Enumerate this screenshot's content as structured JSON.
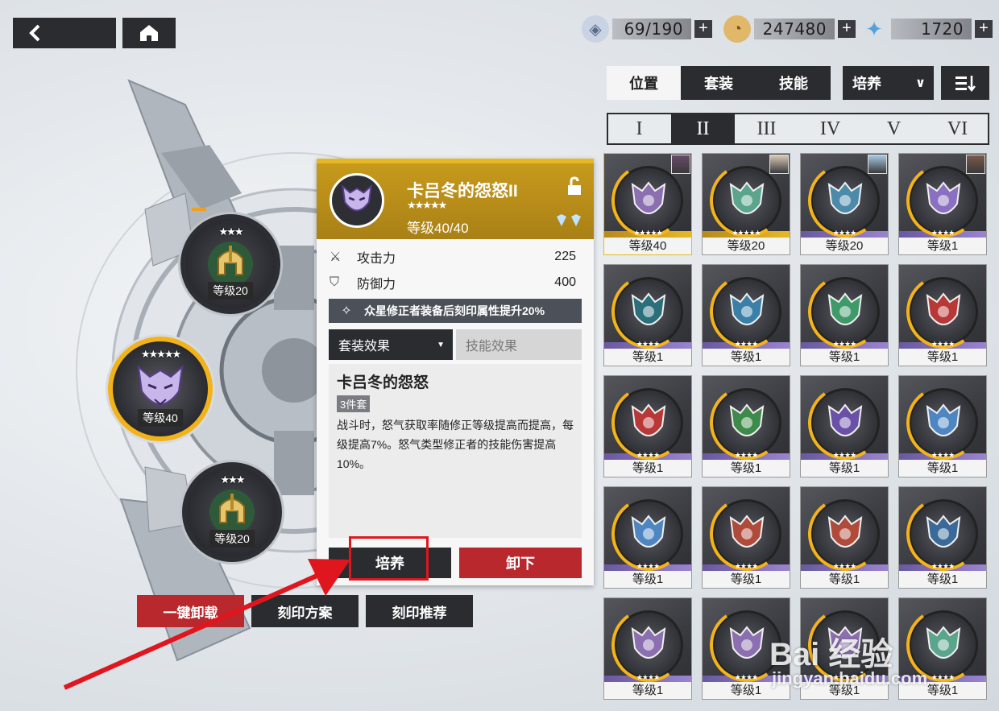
{
  "top_bar": {
    "back_icon": "chevron-left-icon",
    "home_icon": "home-icon",
    "resources": [
      {
        "name": "stamina",
        "icon": "robot-stamina-icon",
        "value": "69/190"
      },
      {
        "name": "coins",
        "icon": "coin-icon",
        "value": "247480"
      },
      {
        "name": "crystal",
        "icon": "star-crystal-icon",
        "value": "1720"
      }
    ],
    "plus": "+"
  },
  "machine": {
    "slots": [
      {
        "stars": "★★★",
        "level": "等级20"
      },
      {
        "stars": "★★★★★",
        "level": "等级40"
      },
      {
        "stars": "★★★",
        "level": "等级20"
      }
    ]
  },
  "bottom_buttons": {
    "unequip_all": "一键卸载",
    "imprint_plan": "刻印方案",
    "imprint_recommend": "刻印推荐"
  },
  "detail": {
    "title": "卡吕冬的怨怒II",
    "stars": "★★★★★",
    "level": "等级40/40",
    "stats": [
      {
        "icon": "sword-icon",
        "label": "攻击力",
        "value": "225"
      },
      {
        "icon": "shield-icon",
        "label": "防御力",
        "value": "400"
      }
    ],
    "bonus": "众星修正者装备后刻印属性提升20%",
    "tabs": {
      "set_effect": "套装效果",
      "skill_effect": "技能效果",
      "dropdown_mark": "▼"
    },
    "set_name": "卡吕冬的怨怒",
    "set_badge": "3件套",
    "set_desc": "战斗时，怒气获取率随修正等级提高而提高，每级提高7%。怒气类型修正者的技能伤害提高10%。",
    "train": "培养",
    "unequip": "卸下"
  },
  "right": {
    "tabs": [
      "位置",
      "套装",
      "技能"
    ],
    "filter": "培养",
    "filter_arrow": "∨",
    "sort_icon": "sort-icon",
    "positions": [
      "I",
      "II",
      "III",
      "IV",
      "V",
      "VI"
    ],
    "active_position": 1,
    "cards": [
      {
        "emblem": "demon-mask-purple",
        "stars": "★★★★★",
        "level": "等级40",
        "color": "#8b6fb0"
      },
      {
        "emblem": "infinity-knot",
        "stars": "★★★★★",
        "level": "等级20",
        "color": "#5aa58c"
      },
      {
        "emblem": "temple-pillar",
        "stars": "★★★★",
        "level": "等级20",
        "color": "#4b8aa8"
      },
      {
        "emblem": "winged-banner",
        "stars": "★★★★",
        "level": "等级1",
        "color": "#8a70c0"
      },
      {
        "emblem": "spear-head",
        "stars": "★★★★",
        "level": "等级1",
        "color": "#2a6f7a"
      },
      {
        "emblem": "swan",
        "stars": "★★★★",
        "level": "等级1",
        "color": "#3a7fa8"
      },
      {
        "emblem": "lyre",
        "stars": "★★★★",
        "level": "等级1",
        "color": "#3f9a6a"
      },
      {
        "emblem": "red-oni-swords",
        "stars": "★★★★",
        "level": "等级1",
        "color": "#b83838"
      },
      {
        "emblem": "red-oni-swords",
        "stars": "★★★★",
        "level": "等级1",
        "color": "#b83838"
      },
      {
        "emblem": "golden-phoenix",
        "stars": "★★★★",
        "level": "等级1",
        "color": "#3e8a4a"
      },
      {
        "emblem": "purple-crest",
        "stars": "★★★★",
        "level": "等级1",
        "color": "#6b50a8"
      },
      {
        "emblem": "blue-dragon",
        "stars": "★★★★",
        "level": "等级1",
        "color": "#4e86c2"
      },
      {
        "emblem": "blue-dragon",
        "stars": "★★★★",
        "level": "等级1",
        "color": "#4e86c2"
      },
      {
        "emblem": "flame-crest",
        "stars": "★★★★",
        "level": "等级1",
        "color": "#b04a3a"
      },
      {
        "emblem": "flame-crest",
        "stars": "★★★★",
        "level": "等级1",
        "color": "#b04a3a"
      },
      {
        "emblem": "blue-swirl",
        "stars": "★★★★",
        "level": "等级1",
        "color": "#3a6a9a"
      },
      {
        "emblem": "demon-mask-purple",
        "stars": "★★★★",
        "level": "等级1",
        "color": "#8b6fb0"
      },
      {
        "emblem": "demon-mask-purple",
        "stars": "★★★★",
        "level": "等级1",
        "color": "#8b6fb0"
      },
      {
        "emblem": "demon-mask-purple",
        "stars": "★★★★",
        "level": "等级1",
        "color": "#8b6fb0"
      },
      {
        "emblem": "infinity-knot",
        "stars": "★★★★",
        "level": "等级1",
        "color": "#5aa58c"
      }
    ]
  },
  "watermark": {
    "main": "Bai 经验",
    "sub": "jingyan.baidu.com"
  },
  "colors": {
    "accent_gold": "#e7b824",
    "highlight_red": "#e0161e",
    "button_red": "#b8282c",
    "dark": "#2b2c30"
  }
}
